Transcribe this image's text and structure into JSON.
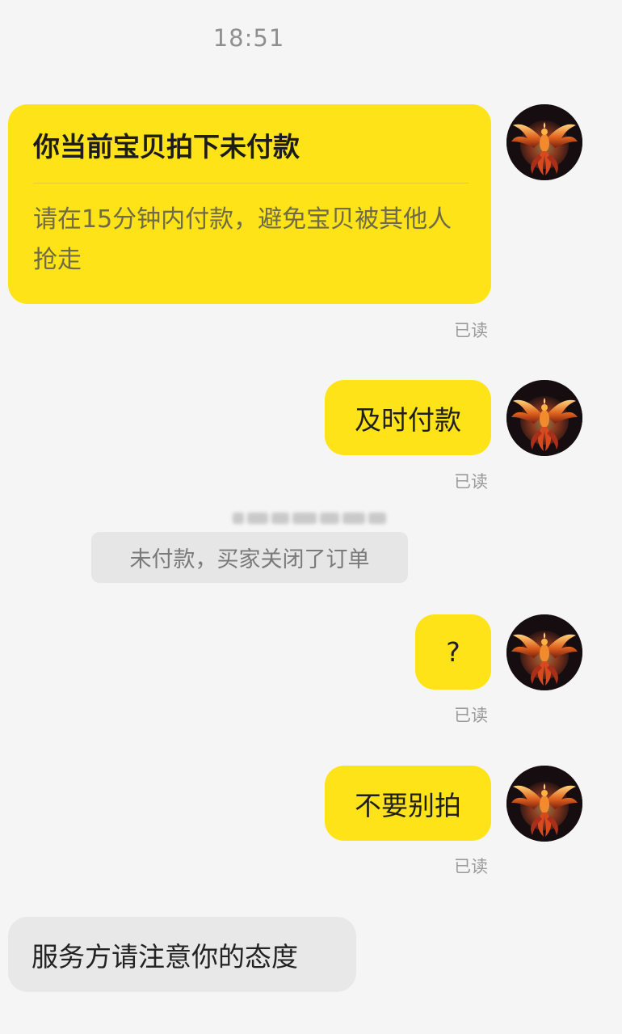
{
  "chat": {
    "timestamp": "18:51",
    "order_card": {
      "title": "你当前宝贝拍下未付款",
      "body": "请在15分钟内付款，避免宝贝被其他人抢走"
    },
    "messages": [
      {
        "text": "及时付款"
      },
      {
        "text": "?"
      },
      {
        "text": "不要别拍"
      }
    ],
    "read_status": [
      "已读",
      "已读",
      "已读",
      "已读"
    ],
    "system_notice": "未付款，买家关闭了订单",
    "incoming_message": "服务方请注意你的态度"
  },
  "colors": {
    "page_background": "#f5f5f5",
    "outgoing_bubble": "#fde318",
    "incoming_bubble": "#e8e8e8",
    "system_notice_bg": "#e6e6e6"
  },
  "icons": {
    "avatar": "phoenix-avatar-icon"
  }
}
